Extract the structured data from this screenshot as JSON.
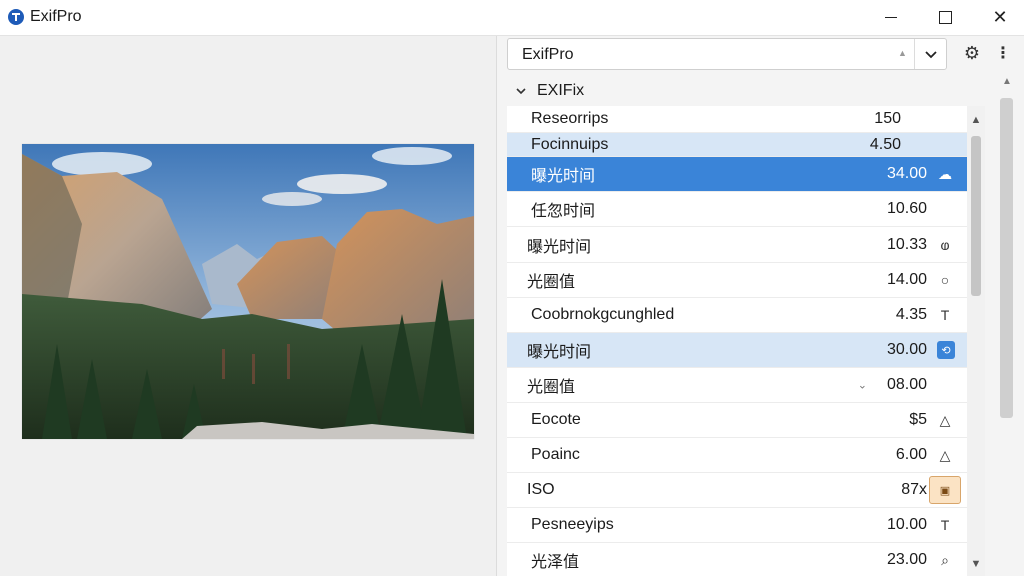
{
  "window": {
    "title": "ExifPro"
  },
  "preset": {
    "value": "ExifPro"
  },
  "section": {
    "label": "EXIFix"
  },
  "rows": [
    {
      "name": "Reseorrips",
      "value": "150",
      "icon": "",
      "style": "normal"
    },
    {
      "name": "Focinnuips",
      "value": "4.50",
      "icon": "",
      "style": "highlight"
    },
    {
      "name": "曝光时间",
      "value": "34.00",
      "icon": "☁",
      "icon_name": "cloud-sync-icon",
      "style": "selected"
    },
    {
      "name": "任忽时间",
      "value": "10.60",
      "icon": "",
      "style": "normal"
    },
    {
      "name": "曝光时间",
      "value": "10.33",
      "icon": "ⱷ",
      "icon_name": "rotate-icon",
      "style": "normal"
    },
    {
      "name": "光圈值",
      "value": "14.00",
      "icon": "○",
      "icon_name": "aperture-icon",
      "style": "normal"
    },
    {
      "name": "Coobrnokgcunghled",
      "value": "4.35",
      "icon": "T",
      "icon_name": "text-icon",
      "style": "normal"
    },
    {
      "name": "曝光时间",
      "value": "30.00",
      "icon": "⟲",
      "icon_name": "refresh-badge-icon",
      "style": "highlight"
    },
    {
      "name": "光圈值",
      "value": "08.00",
      "icon": "",
      "dropdown": "⌄",
      "style": "normal"
    },
    {
      "name": "Eocote",
      "value": "$5",
      "icon": "△",
      "icon_name": "up-arrow-icon",
      "style": "normal"
    },
    {
      "name": "Poainc",
      "value": "6.00",
      "icon": "△",
      "icon_name": "triangle-icon",
      "style": "normal"
    },
    {
      "name": "ISO",
      "value": "87x",
      "icon": "▣",
      "icon_name": "iso-badge-icon",
      "style": "normal"
    },
    {
      "name": "Pesneeyips",
      "value": "10.00",
      "icon": "T",
      "icon_name": "text-icon",
      "style": "normal"
    },
    {
      "name": "光泽值",
      "value": "23.00",
      "icon": "⌕",
      "icon_name": "search-icon",
      "style": "normal"
    }
  ]
}
